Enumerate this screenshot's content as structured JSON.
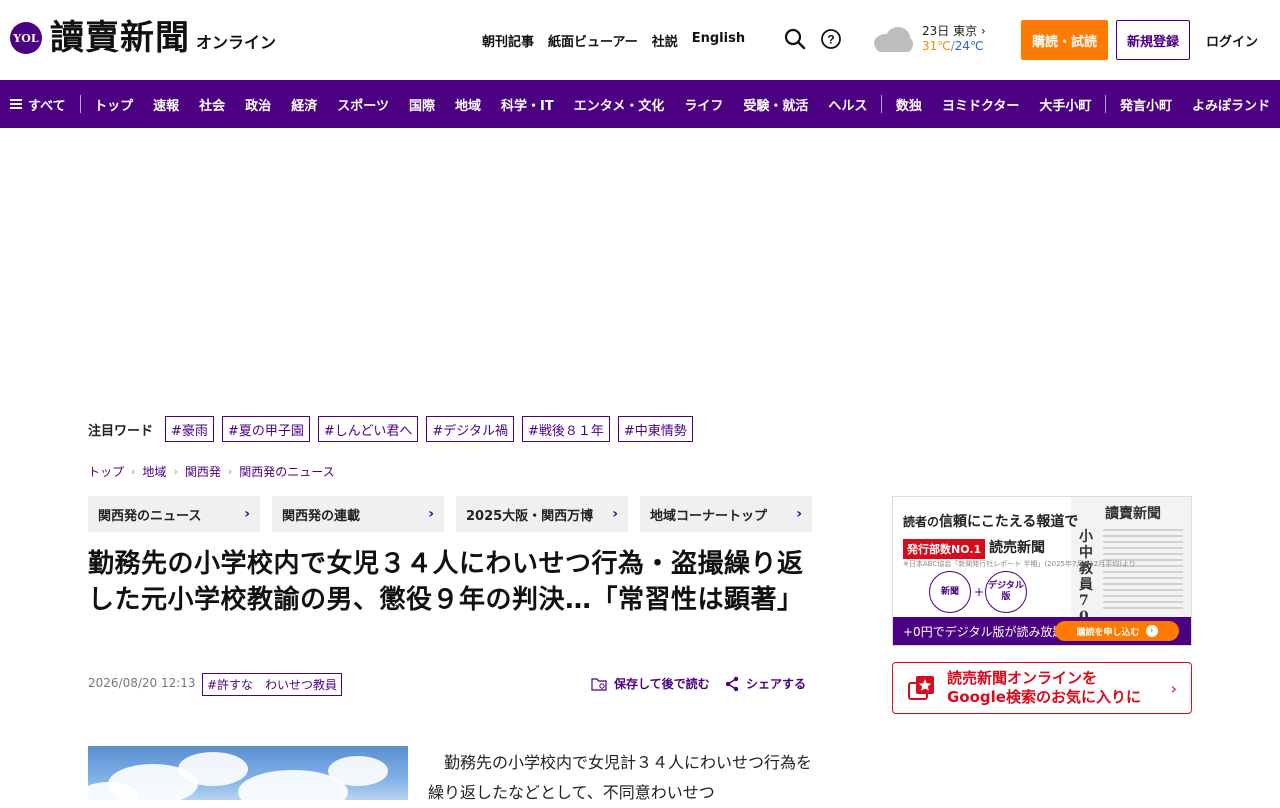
{
  "header": {
    "logo_badge": "YOL",
    "logo_main": "讀賣新聞",
    "logo_sub": "オンライン",
    "top_links": [
      "朝刊記事",
      "紙面ビューアー",
      "社説",
      "English"
    ],
    "weather": {
      "date_city": "23日 東京",
      "high": "31℃",
      "sep": "/",
      "low": "24℃"
    },
    "subscribe_label": "購読・試読",
    "register_label": "新規登録",
    "login_label": "ログイン",
    "colors": {
      "brand": "#4b0082",
      "accent": "#ff7a00"
    }
  },
  "catnav": {
    "menu_label": "すべて",
    "group1": [
      "トップ",
      "速報",
      "社会",
      "政治",
      "経済",
      "スポーツ",
      "国際",
      "地域",
      "科学・IT",
      "エンタメ・文化",
      "ライフ",
      "受験・就活",
      "ヘルス"
    ],
    "group2": [
      "数独",
      "ヨミドクター",
      "大手小町"
    ],
    "group3": [
      "発言小町",
      "よみぽランド"
    ]
  },
  "hotwords": {
    "label": "注目ワード",
    "tags": [
      "#豪雨",
      "#夏の甲子園",
      "#しんどい君へ",
      "#デジタル禍",
      "#戦後８１年",
      "#中東情勢"
    ]
  },
  "breadcrumb": [
    "トップ",
    "地域",
    "関西発",
    "関西発のニュース"
  ],
  "subnav": [
    "関西発のニュース",
    "関西発の連載",
    "2025大阪・関西万博",
    "地域コーナートップ"
  ],
  "article": {
    "title": "勤務先の小学校内で女児３４人にわいせつ行為・盗撮繰り返した元小学校教諭の男、懲役９年の判決…「常習性は顕著」",
    "date": "2026/08/20 12:13",
    "tag": "#許すな　わいせつ教員",
    "save_label": "保存して後で読む",
    "share_label": "シェアする",
    "body": "　勤務先の小学校内で女児計３４人にわいせつ行為を繰り返したなどとして、不同意わいせつ"
  },
  "promo": {
    "headline_a": "読者の",
    "headline_b": "信頼にこたえる報道で",
    "no1_label": "発行部数NO.1",
    "brand": "読売新聞",
    "note": "※日本ABC協会「新聞発行社レポート 半期」(2025年7月~12月平均)より",
    "paper_masthead": "讀賣新聞",
    "paper_headline": "小中教員700人増",
    "circle_paper": "新聞",
    "plus": "+",
    "circle_digital": "デジタル版",
    "bar_text": "+0円でデジタル版が読み放題!",
    "bar_button": "購読を申し込む"
  },
  "google_banner": {
    "line1": "読売新聞オンラインを",
    "line2": "Google検索のお気に入りに"
  }
}
